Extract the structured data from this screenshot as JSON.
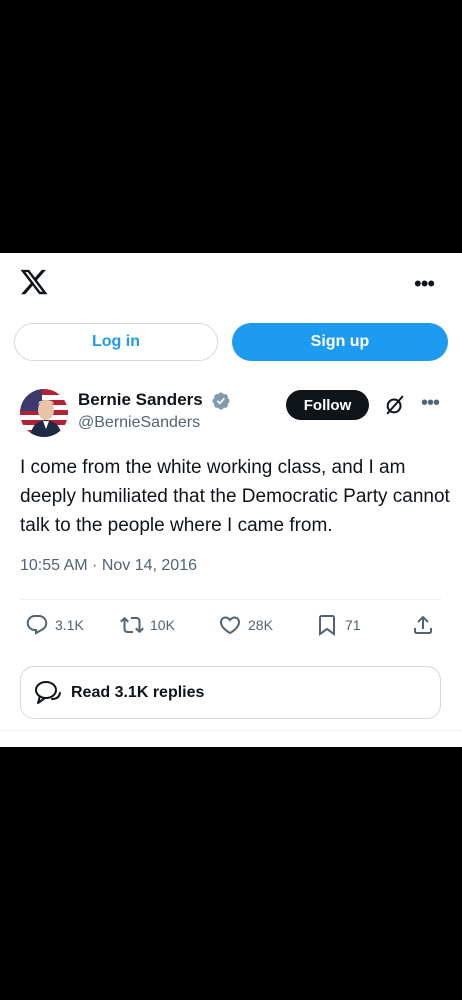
{
  "header": {
    "logo": "x-logo-icon",
    "more_icon": "more-horizontal-icon",
    "more_label": "•••"
  },
  "auth": {
    "login_label": "Log in",
    "signup_label": "Sign up"
  },
  "author": {
    "name": "Bernie Sanders",
    "handle": "@BernieSanders",
    "verified": true,
    "follow_label": "Follow"
  },
  "tweet": {
    "text": "I come from the white working class, and I am deeply humiliated that the Democratic Party cannot talk to the people where I came from.",
    "timestamp": "10:55 AM · Nov 14, 2016"
  },
  "stats": {
    "replies": "3.1K",
    "reposts": "10K",
    "likes": "28K",
    "bookmarks": "71"
  },
  "read_replies_label": "Read 3.1K replies",
  "colors": {
    "accent": "#1d9bf0",
    "text": "#0f1419",
    "muted": "#536471",
    "border": "#cfd9de"
  }
}
